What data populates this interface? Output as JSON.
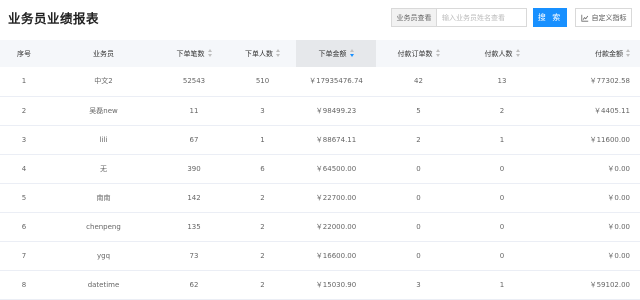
{
  "page": {
    "title": "业务员业绩报表"
  },
  "search": {
    "label": "业务员查看",
    "placeholder": "输入业务员姓名查看",
    "value": "",
    "button_label": "搜 索"
  },
  "custom_button": {
    "label": "自定义指标",
    "icon": "chart-line-icon"
  },
  "table": {
    "columns": [
      {
        "label": "序号",
        "sortable": false
      },
      {
        "label": "业务员",
        "sortable": false
      },
      {
        "label": "下单笔数",
        "sortable": true
      },
      {
        "label": "下单人数",
        "sortable": true
      },
      {
        "label": "下单金额",
        "sortable": true,
        "sort": "desc"
      },
      {
        "label": "付款订单数",
        "sortable": true
      },
      {
        "label": "付款人数",
        "sortable": true
      },
      {
        "label": "付款金额",
        "sortable": true
      }
    ],
    "rows": [
      {
        "idx": "1",
        "name": "中文2",
        "order_count": "52543",
        "order_users": "510",
        "order_amount": "￥17935476.74",
        "paid_orders": "42",
        "paid_users": "13",
        "paid_amount": "￥77302.58"
      },
      {
        "idx": "2",
        "name": "吴磊new",
        "order_count": "11",
        "order_users": "3",
        "order_amount": "￥98499.23",
        "paid_orders": "5",
        "paid_users": "2",
        "paid_amount": "￥4405.11"
      },
      {
        "idx": "3",
        "name": "lili",
        "order_count": "67",
        "order_users": "1",
        "order_amount": "￥88674.11",
        "paid_orders": "2",
        "paid_users": "1",
        "paid_amount": "￥11600.00"
      },
      {
        "idx": "4",
        "name": "无",
        "order_count": "390",
        "order_users": "6",
        "order_amount": "￥64500.00",
        "paid_orders": "0",
        "paid_users": "0",
        "paid_amount": "￥0.00"
      },
      {
        "idx": "5",
        "name": "南南",
        "order_count": "142",
        "order_users": "2",
        "order_amount": "￥22700.00",
        "paid_orders": "0",
        "paid_users": "0",
        "paid_amount": "￥0.00"
      },
      {
        "idx": "6",
        "name": "chenpeng",
        "order_count": "135",
        "order_users": "2",
        "order_amount": "￥22000.00",
        "paid_orders": "0",
        "paid_users": "0",
        "paid_amount": "￥0.00"
      },
      {
        "idx": "7",
        "name": "ygq",
        "order_count": "73",
        "order_users": "2",
        "order_amount": "￥16600.00",
        "paid_orders": "0",
        "paid_users": "0",
        "paid_amount": "￥0.00"
      },
      {
        "idx": "8",
        "name": "datetime",
        "order_count": "62",
        "order_users": "2",
        "order_amount": "￥15030.90",
        "paid_orders": "3",
        "paid_users": "1",
        "paid_amount": "￥59102.00"
      }
    ]
  }
}
